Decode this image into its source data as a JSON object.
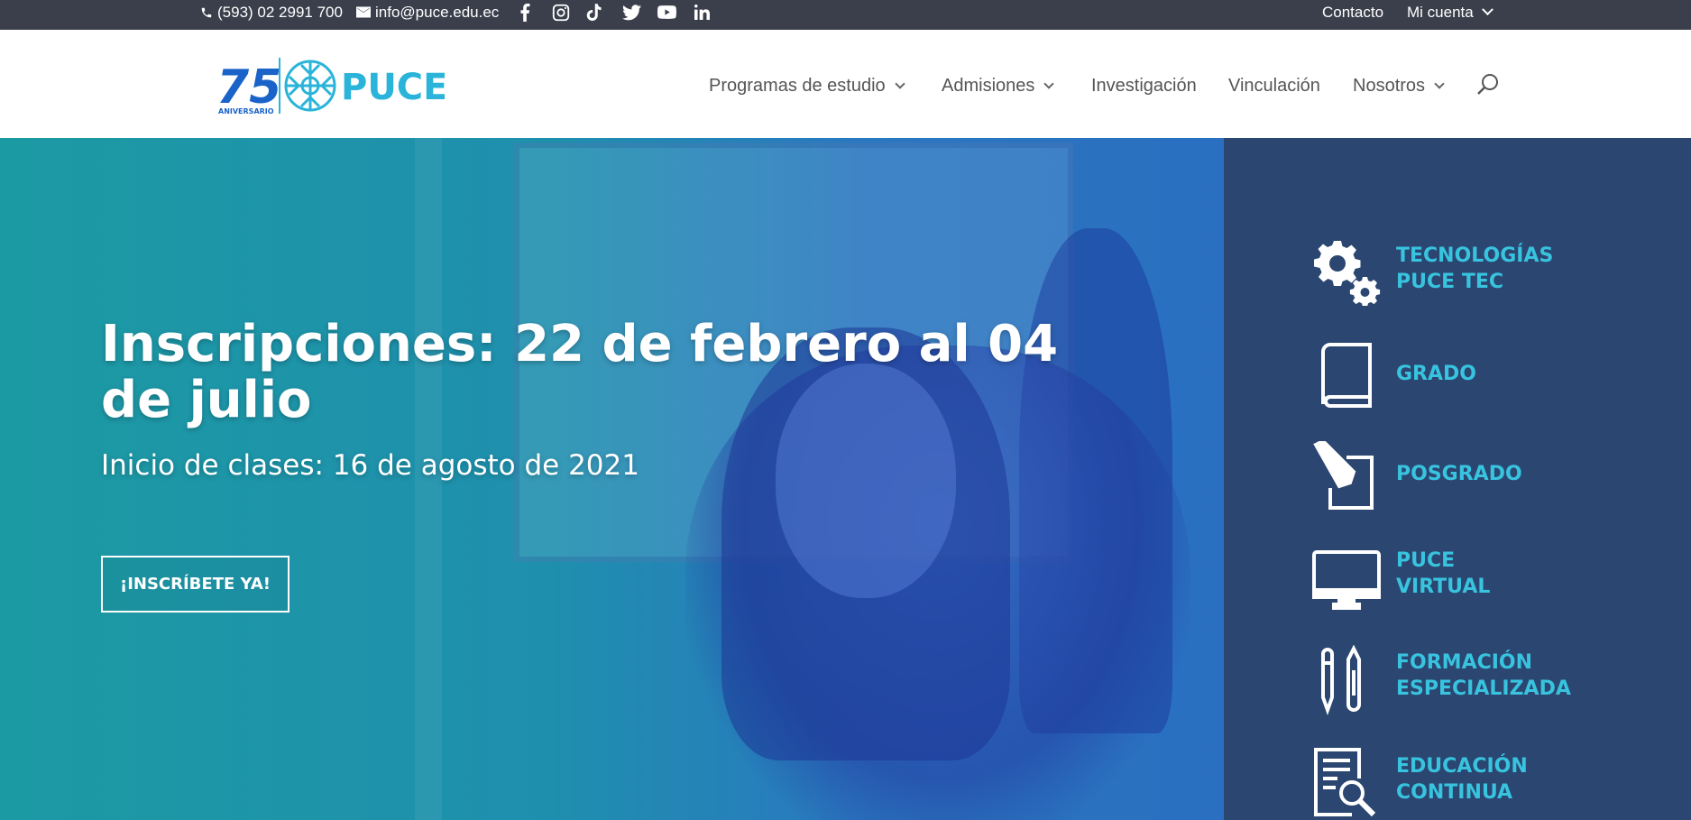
{
  "topbar": {
    "phone": "(593) 02 2991 700",
    "email": "info@puce.edu.ec",
    "social": [
      "facebook-icon",
      "instagram-icon",
      "tiktok-icon",
      "twitter-icon",
      "youtube-icon",
      "linkedin-icon"
    ],
    "contact": "Contacto",
    "account": "Mi cuenta"
  },
  "logo": {
    "anniversary": "75",
    "anniversary_label": "ANIVERSARIO",
    "brand": "PUCE"
  },
  "nav": {
    "programs": "Programas de estudio",
    "admissions": "Admisiones",
    "research": "Investigación",
    "outreach": "Vinculación",
    "about": "Nosotros"
  },
  "hero": {
    "title": "Inscripciones: 22 de febrero al 04 de julio",
    "subtitle": "Inicio de clases: 16 de agosto de 2021",
    "cta": "¡INSCRÍBETE YA!"
  },
  "panel": {
    "items": [
      {
        "line1": "TECNOLOGÍAS",
        "line2": "PUCE TEC",
        "icon": "gears-icon"
      },
      {
        "line1": "GRADO",
        "line2": "",
        "icon": "book-icon"
      },
      {
        "line1": "POSGRADO",
        "line2": "",
        "icon": "pencil-document-icon"
      },
      {
        "line1": "PUCE",
        "line2": "VIRTUAL",
        "icon": "monitor-icon"
      },
      {
        "line1": "FORMACIÓN",
        "line2": "ESPECIALIZADA",
        "icon": "pens-icon"
      },
      {
        "line1": "EDUCACIÓN",
        "line2": "CONTINUA",
        "icon": "document-search-icon"
      }
    ]
  },
  "colors": {
    "topbar": "#3b3f4c",
    "panel": "#2b4670",
    "panel_label": "#38c3df",
    "hero": "#1c9aa3"
  }
}
